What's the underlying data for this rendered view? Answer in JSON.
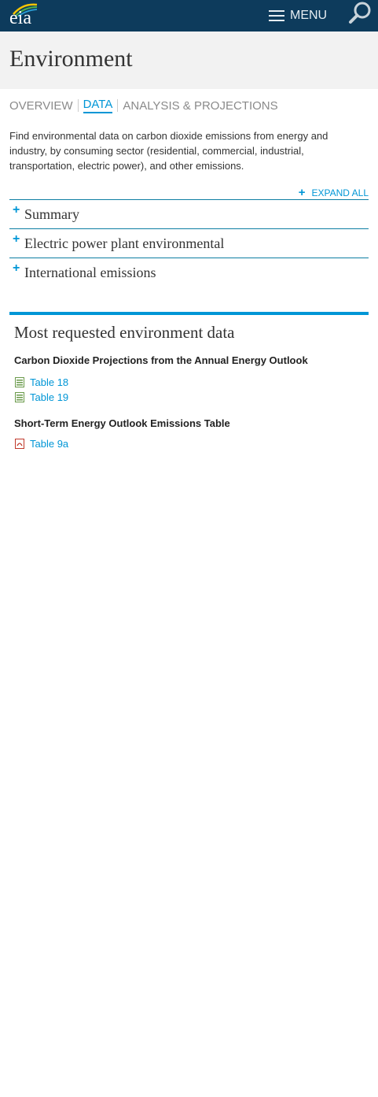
{
  "header": {
    "logo_text": "eia",
    "menu_label": "MENU"
  },
  "page": {
    "title": "Environment"
  },
  "subnav": {
    "items": [
      {
        "label": "OVERVIEW",
        "active": false
      },
      {
        "label": "DATA",
        "active": true
      },
      {
        "label": "ANALYSIS & PROJECTIONS",
        "active": false
      }
    ]
  },
  "intro": "Find environmental data on carbon dioxide emissions from energy and industry, by consuming sector (residential, commercial, industrial, transportation, electric power), and other emissions.",
  "accordion": {
    "expand_all_label": "EXPAND ALL",
    "items": [
      {
        "label": "Summary"
      },
      {
        "label": "Electric power plant environmental"
      },
      {
        "label": "International emissions"
      }
    ]
  },
  "most_requested": {
    "title": "Most requested environment data",
    "groups": [
      {
        "title": "Carbon Dioxide Projections from the Annual Energy Outlook",
        "links": [
          {
            "label": "Table 18",
            "icon": "excel-file-icon"
          },
          {
            "label": "Table 19",
            "icon": "excel-file-icon"
          }
        ]
      },
      {
        "title": "Short-Term Energy Outlook Emissions Table",
        "links": [
          {
            "label": "Table 9a",
            "icon": "pdf-file-icon"
          }
        ]
      }
    ]
  },
  "colors": {
    "header_bg": "#0d3b5c",
    "accent": "#0096d6",
    "title_band": "#f2f2f2"
  }
}
